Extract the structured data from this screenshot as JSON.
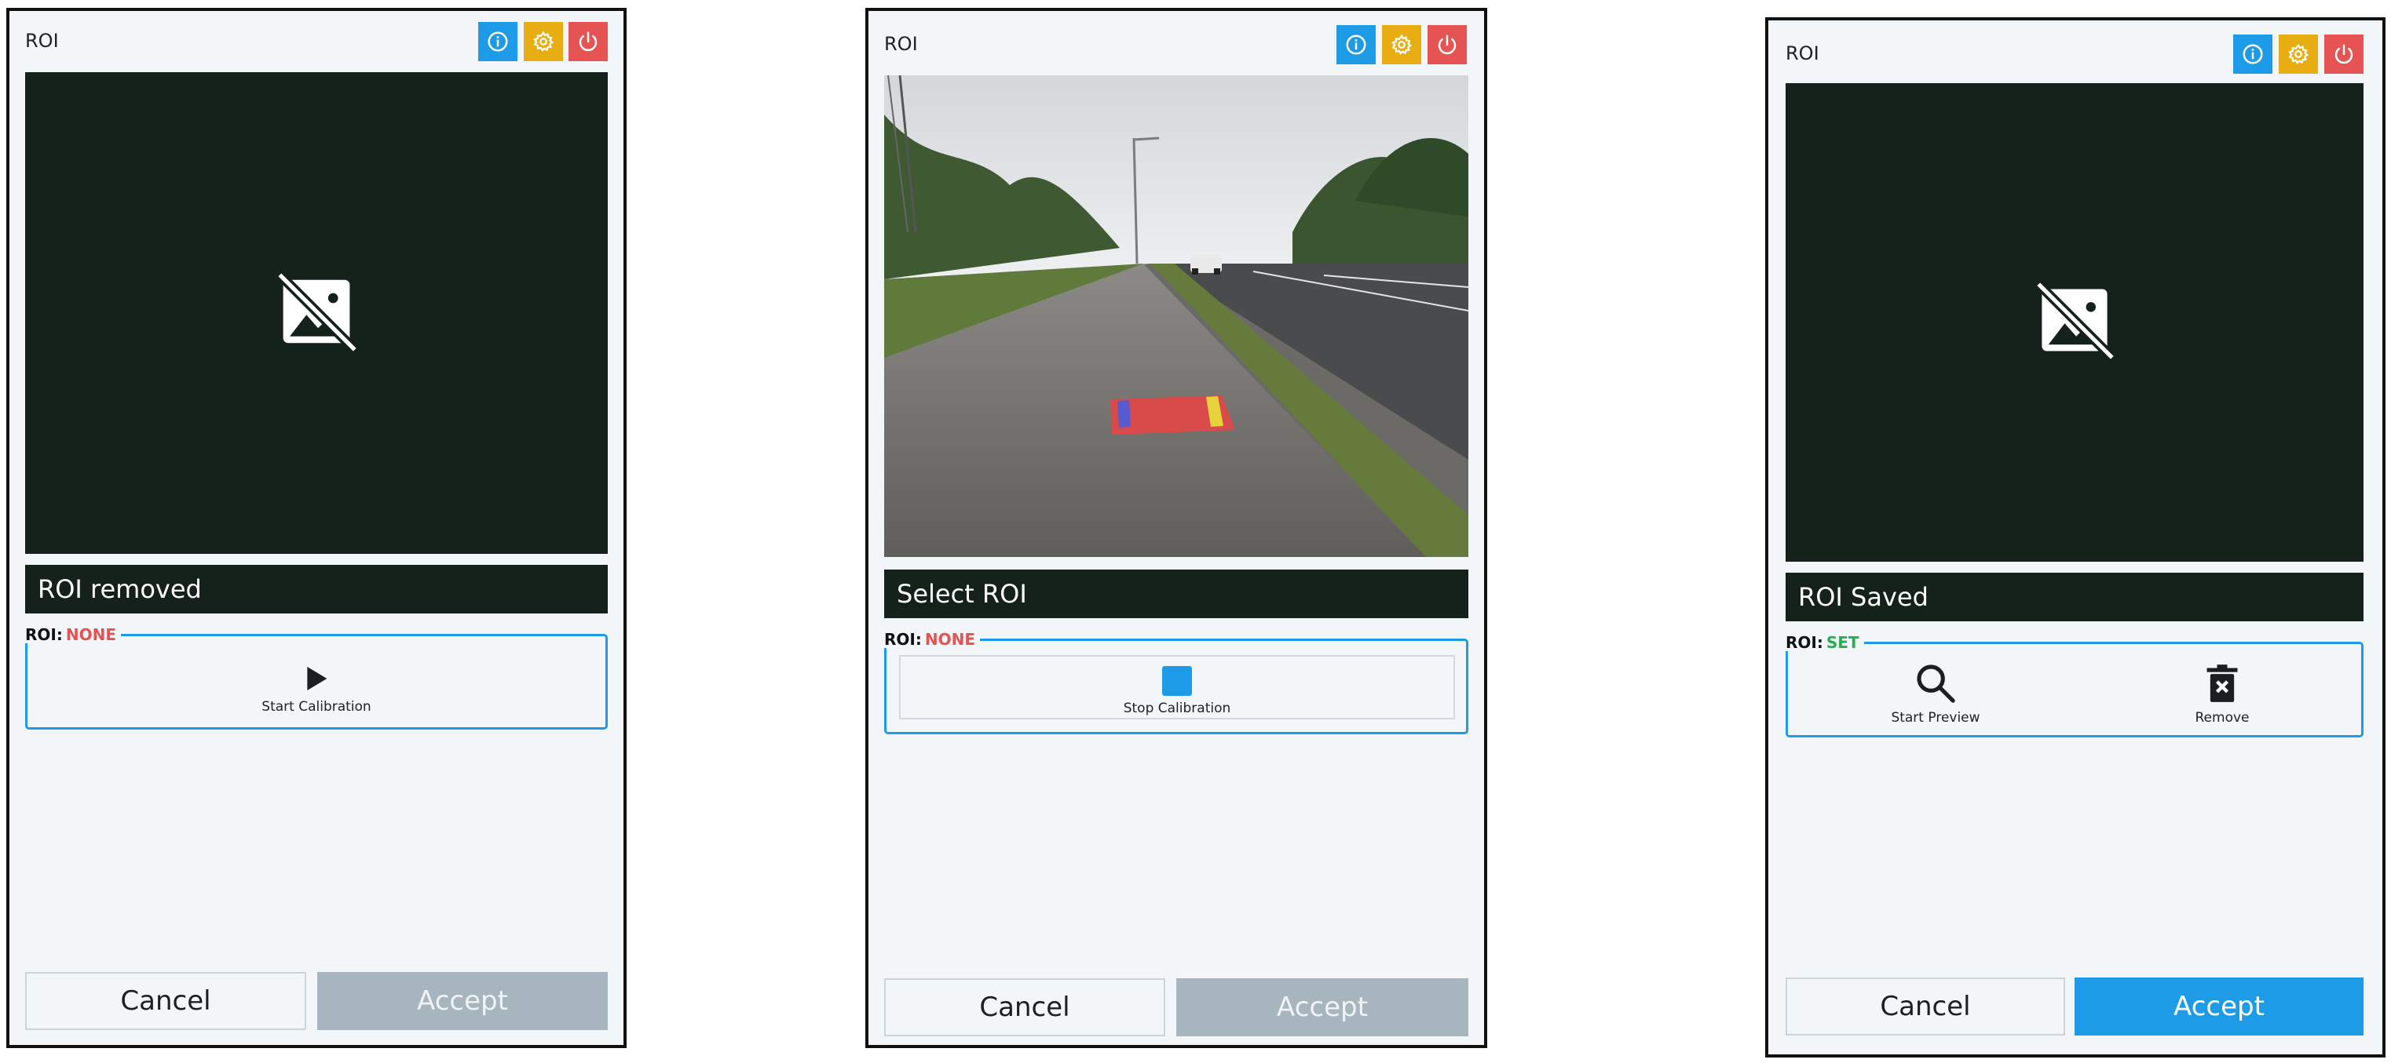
{
  "panels": [
    {
      "title": "ROI",
      "status": "ROI removed",
      "roi_label": "ROI:",
      "roi_value": "NONE",
      "action_label": "Start Calibration",
      "cancel": "Cancel",
      "accept": "Accept",
      "accept_enabled": false,
      "view": "no-image"
    },
    {
      "title": "ROI",
      "status": "Select ROI",
      "roi_label": "ROI:",
      "roi_value": "NONE",
      "action_label": "Stop Calibration",
      "cancel": "Cancel",
      "accept": "Accept",
      "accept_enabled": false,
      "view": "camera-feed"
    },
    {
      "title": "ROI",
      "status": "ROI Saved",
      "roi_label": "ROI:",
      "roi_value": "SET",
      "action_labels": [
        "Start Preview",
        "Remove"
      ],
      "cancel": "Cancel",
      "accept": "Accept",
      "accept_enabled": true,
      "view": "no-image"
    }
  ],
  "colors": {
    "info": "#1e9be6",
    "settings": "#e8ad12",
    "power": "#e55353",
    "roi_none": "#e55353",
    "roi_set": "#22b14c",
    "dark": "#15221b"
  },
  "icons": [
    "info-icon",
    "gear-icon",
    "power-icon",
    "image-off-icon",
    "play-icon",
    "stop-icon",
    "search-icon",
    "trash-icon"
  ]
}
